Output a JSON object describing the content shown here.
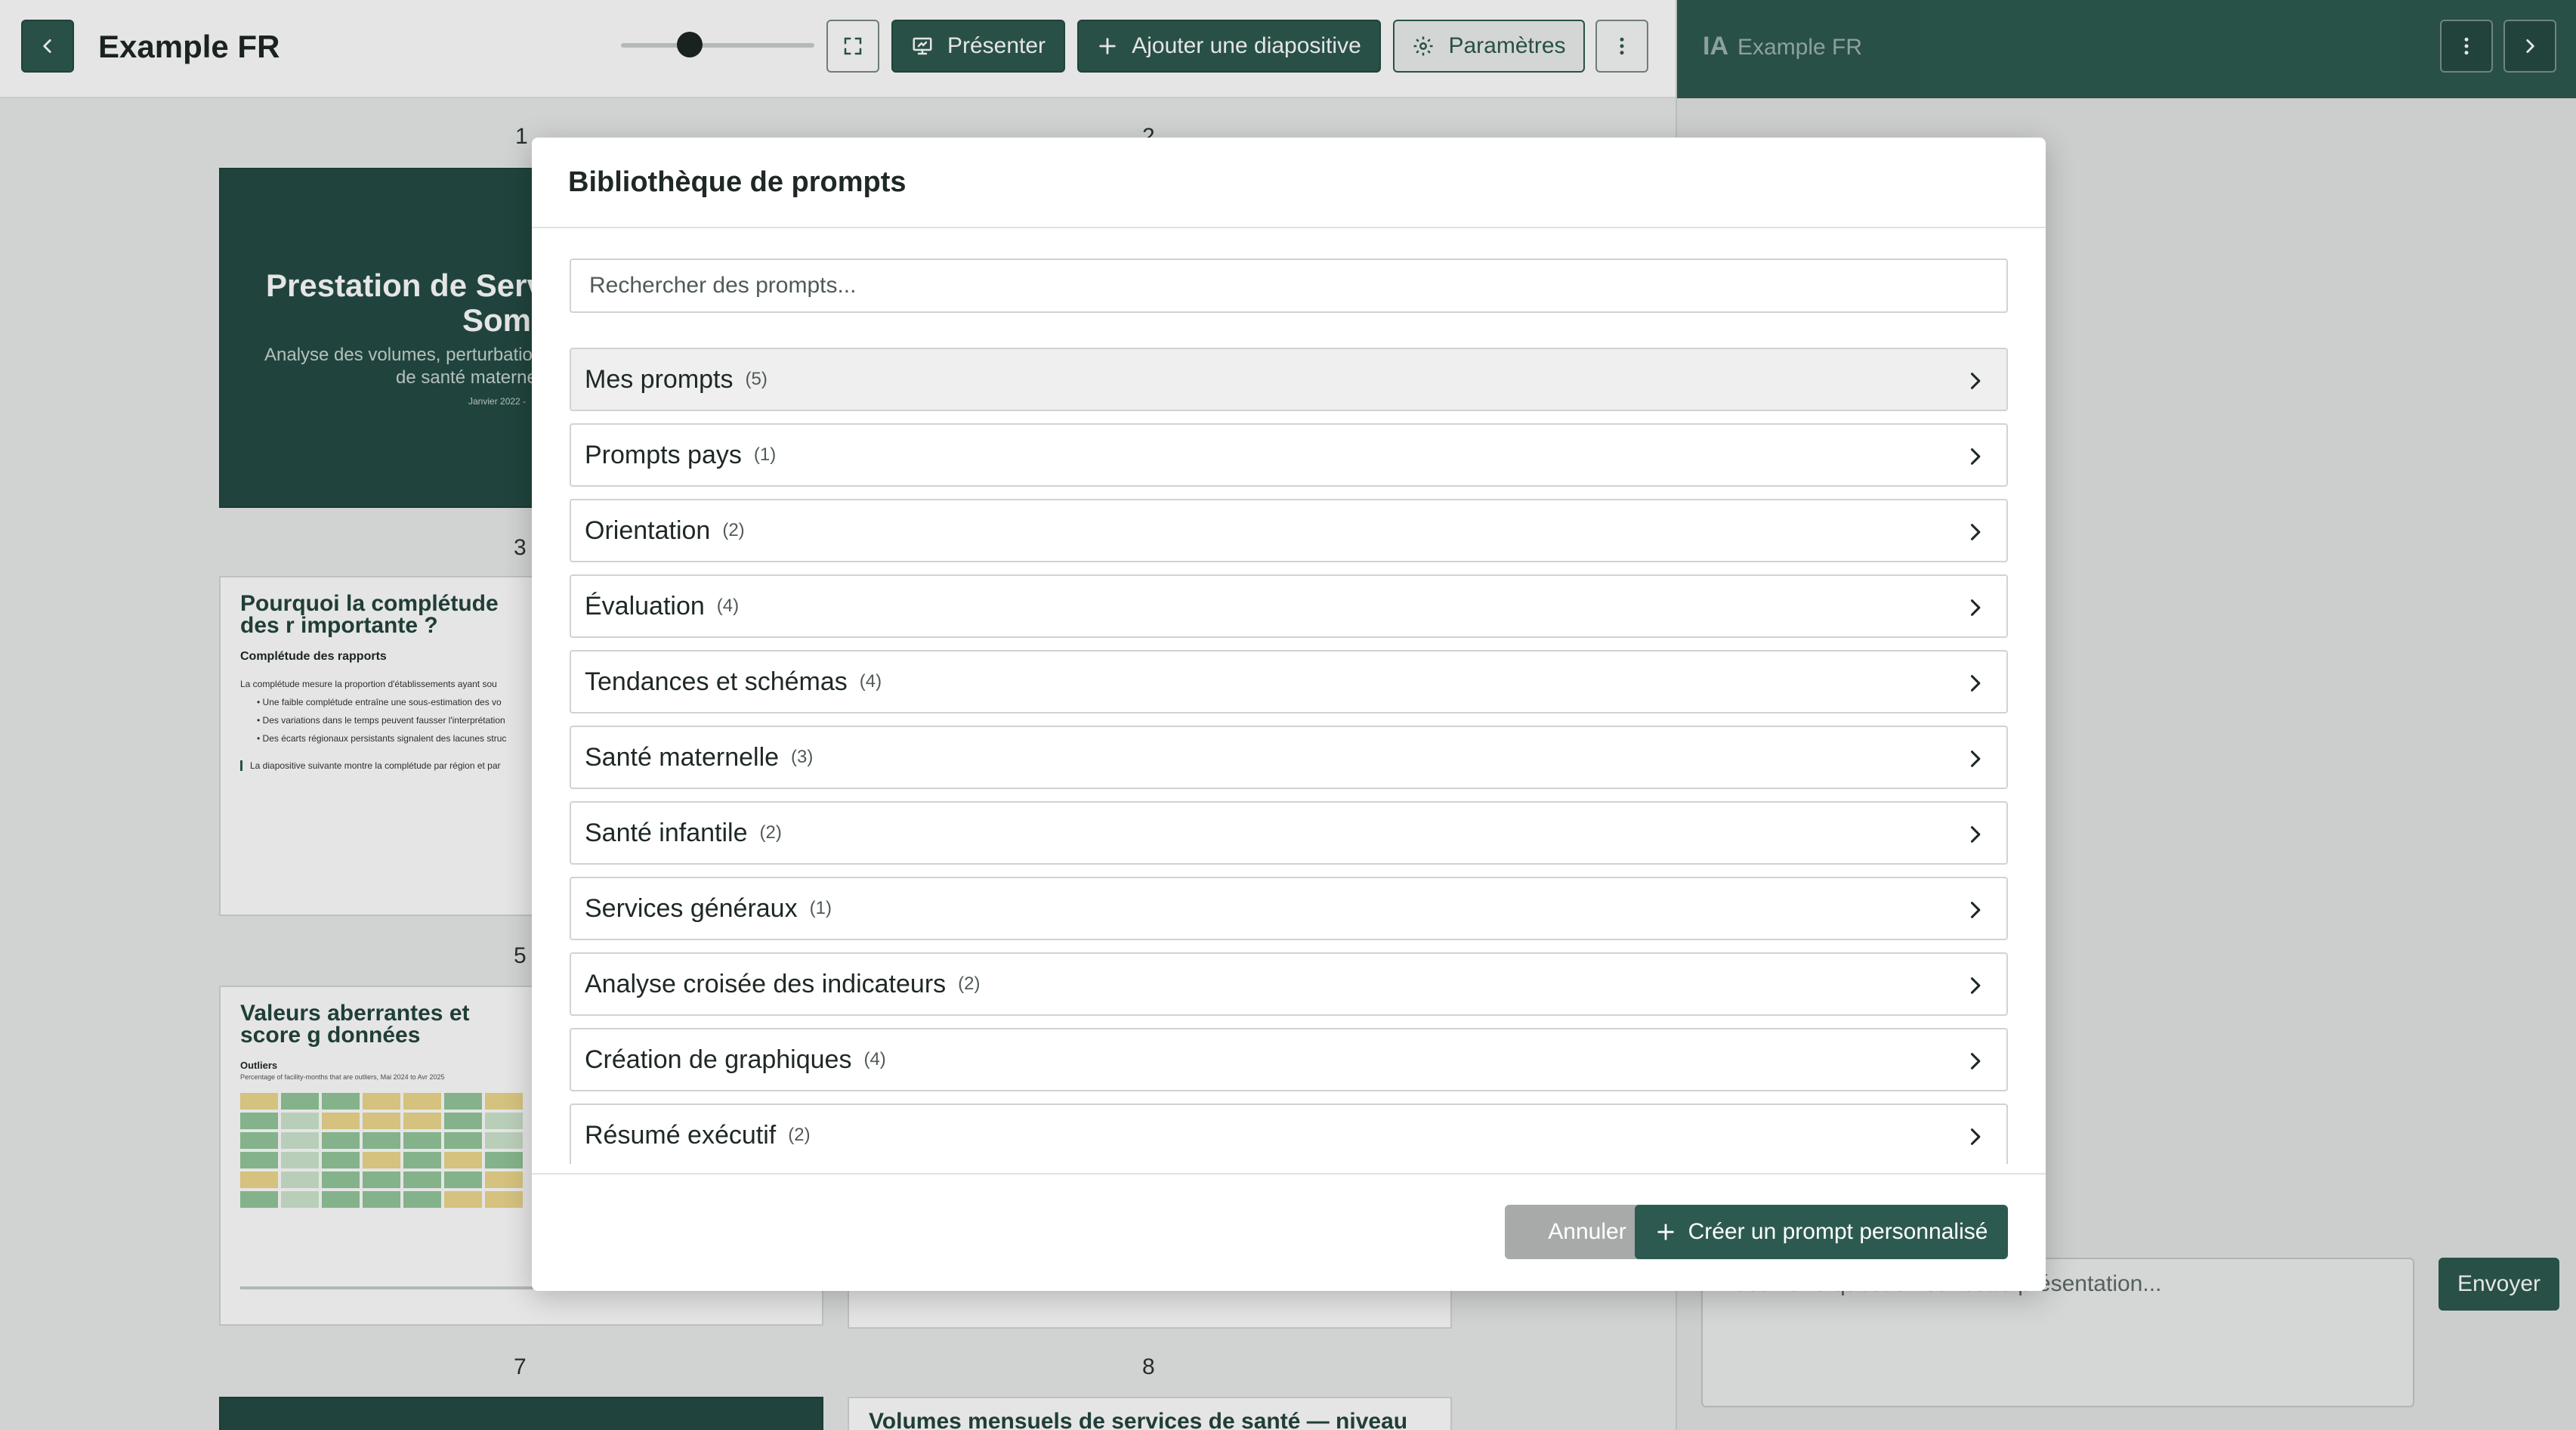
{
  "header": {
    "title": "Example FR",
    "present_label": "Présenter",
    "add_slide_label": "Ajouter une diapositive",
    "settings_label": "Paramètres"
  },
  "slides": {
    "numbers": [
      "1",
      "2",
      "3",
      "5",
      "7",
      "8"
    ],
    "s1": {
      "title_line1": "Prestation de Serv",
      "title_line2": "Soma",
      "subtitle_line1": "Analyse des volumes, perturbatio",
      "subtitle_line2": "de santé materne",
      "date": "Janvier 2022 -"
    },
    "s3": {
      "title": "Pourquoi la complétude des r importante ?",
      "heading": "Complétude des rapports",
      "p1": "La complétude mesure la proportion d'établissements ayant sou",
      "b1": "• Une faible complétude entraîne une sous-estimation des vo",
      "b2": "• Des variations dans le temps peuvent fausser l'interprétation",
      "b3": "• Des écarts régionaux persistants signalent des lacunes struc",
      "quote": "La diapositive suivante montre la complétude par région et par"
    },
    "s5": {
      "title": "Valeurs aberrantes et score g données",
      "heading": "Outliers",
      "caption": "Percentage of facility-months that are outliers, Mai 2024 to Avr 2025"
    },
    "s8": {
      "title": "Volumes mensuels de services de santé — niveau"
    }
  },
  "ai_panel": {
    "label": "IA",
    "title": "Example FR",
    "input_placeholder": "Posez une question sur cette présentation...",
    "send_label": "Envoyer"
  },
  "modal": {
    "title": "Bibliothèque de prompts",
    "search_placeholder": "Rechercher des prompts...",
    "categories": [
      {
        "label": "Mes prompts",
        "count": "(5)"
      },
      {
        "label": "Prompts pays",
        "count": "(1)"
      },
      {
        "label": "Orientation",
        "count": "(2)"
      },
      {
        "label": "Évaluation",
        "count": "(4)"
      },
      {
        "label": "Tendances et schémas",
        "count": "(4)"
      },
      {
        "label": "Santé maternelle",
        "count": "(3)"
      },
      {
        "label": "Santé infantile",
        "count": "(2)"
      },
      {
        "label": "Services généraux",
        "count": "(1)"
      },
      {
        "label": "Analyse croisée des indicateurs",
        "count": "(2)"
      },
      {
        "label": "Création de graphiques",
        "count": "(4)"
      },
      {
        "label": "Résumé exécutif",
        "count": "(2)"
      }
    ],
    "cancel_label": "Annuler",
    "create_label": "Créer un prompt personnalisé"
  },
  "colors": {
    "brand": "#2d5a50",
    "heat_green": "#93c79a",
    "heat_yellow": "#ecd98d",
    "heat_light": "#cfe6cf"
  }
}
